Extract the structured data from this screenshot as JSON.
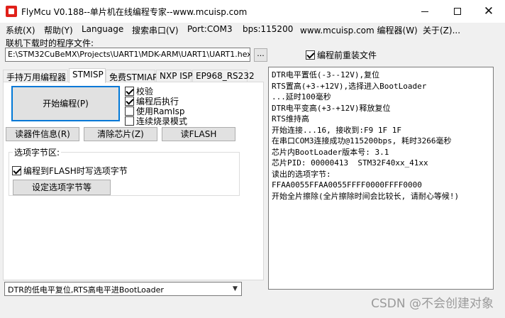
{
  "window": {
    "title": "FlyMcu V0.188--单片机在线编程专家--www.mcuisp.com",
    "icon": "flymcu-app-icon",
    "minimize_glyph": "—",
    "maximize_glyph": "☐",
    "close_glyph": "✕"
  },
  "menu": [
    "系统(X)",
    "帮助(Y)",
    "Language",
    "搜索串口(V)",
    "Port:COM3",
    "bps:115200",
    "www.mcuisp.com 编程器(W)",
    "关于(Z)..."
  ],
  "file": {
    "caption": "联机下载时的程序文件:",
    "path": "E:\\STM32CuBeMX\\Projects\\UART1\\MDK-ARM\\UART1\\UART1.hex",
    "browse_label": "...",
    "reload_checkbox": {
      "label": "编程前重装文件",
      "checked": true
    }
  },
  "tabs": [
    {
      "label": "手持万用编程器",
      "active": false
    },
    {
      "label": "STMISP",
      "active": true
    },
    {
      "label": "免费STMIAP",
      "active": false
    },
    {
      "label": "NXP ISP",
      "active": false
    },
    {
      "label": "EP968_RS232",
      "active": false
    }
  ],
  "stmisp": {
    "start_button": "开始编程(P)",
    "options": [
      {
        "label": "校验",
        "checked": true
      },
      {
        "label": "编程后执行",
        "checked": true
      },
      {
        "label": "使用RamIsp",
        "checked": false
      },
      {
        "label": "连续烧录模式",
        "checked": false
      }
    ],
    "read_info_button": "读器件信息(R)",
    "erase_button": "清除芯片(Z)",
    "read_flash_button": "读FLASH",
    "option_group": {
      "title": "选项字节区:",
      "write_checkbox": {
        "label": "编程到FLASH时写选项字节",
        "checked": true
      },
      "set_button": "设定选项字节等"
    }
  },
  "reset_mode": {
    "selected": "DTR的低电平复位,RTS高电平进BootLoader",
    "arrow_icon": "chevron-down-icon"
  },
  "log": [
    "DTR电平置低(-3--12V),复位",
    "RTS置高(+3-+12V),选择进入BootLoader",
    "...延时100毫秒",
    "DTR电平变高(+3-+12V)释放复位",
    "RTS维持高",
    "开始连接...16, 接收到:F9 1F 1F",
    "在串口COM3连接成功@115200bps, 耗时3266毫秒",
    "芯片内BootLoader版本号: 3.1",
    "芯片PID: 00000413  STM32F40xx_41xx",
    "读出的选项字节:",
    "FFAA0055FFAA0055FFFF0000FFFF0000",
    "开始全片擦除(全片擦除时间会比较长, 请耐心等候!)"
  ],
  "watermark": "CSDN @不会创建对象"
}
